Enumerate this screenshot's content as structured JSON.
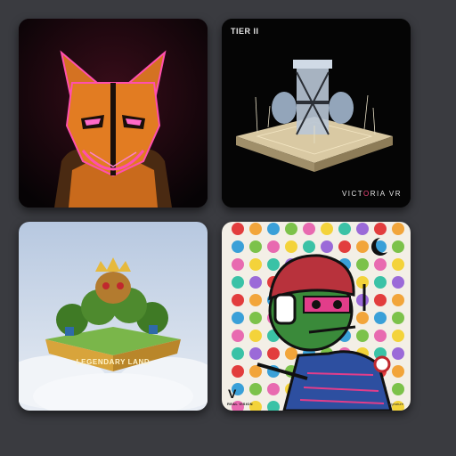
{
  "gallery": {
    "items": [
      {
        "name": "neon-fox-mask-art",
        "palette": {
          "accent": "#ff3fa4",
          "body": "#e27c22",
          "bg": "#0b0508"
        }
      },
      {
        "name": "tier-ii-building-art",
        "badge": "TIER II",
        "brand_prefix": "VICT",
        "brand_accent": "O",
        "brand_suffix": "RIA VR",
        "palette": {
          "bg": "#050505",
          "base": "#d9c9a3"
        }
      },
      {
        "name": "legendary-land-art",
        "label": "LEGENDARY LAND",
        "palette": {
          "sky": "#a9c0dc",
          "cloud": "#e6edf5",
          "grass": "#4e8a2e",
          "gold": "#d8a43b"
        }
      },
      {
        "name": "polka-dot-character-art",
        "logo": "V",
        "logo_text": "REAL VISION",
        "signature": "signature",
        "palette": {
          "bg": "#f3efe6",
          "face": "#3a8a3a",
          "cap": "#b8323c"
        }
      }
    ]
  }
}
